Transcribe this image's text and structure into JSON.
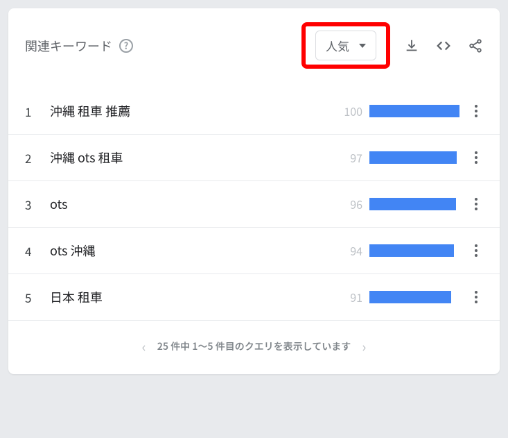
{
  "header": {
    "title": "関連キーワード",
    "dropdown_label": "人気"
  },
  "max_value": 100,
  "items": [
    {
      "rank": "1",
      "keyword": "沖縄 租車 推薦",
      "value": 100
    },
    {
      "rank": "2",
      "keyword": "沖縄 ots 租車",
      "value": 97
    },
    {
      "rank": "3",
      "keyword": "ots",
      "value": 96
    },
    {
      "rank": "4",
      "keyword": "ots 沖縄",
      "value": 94
    },
    {
      "rank": "5",
      "keyword": "日本 租車",
      "value": 91
    }
  ],
  "pager": {
    "text": "25 件中 1～5 件目のクエリを表示しています"
  }
}
